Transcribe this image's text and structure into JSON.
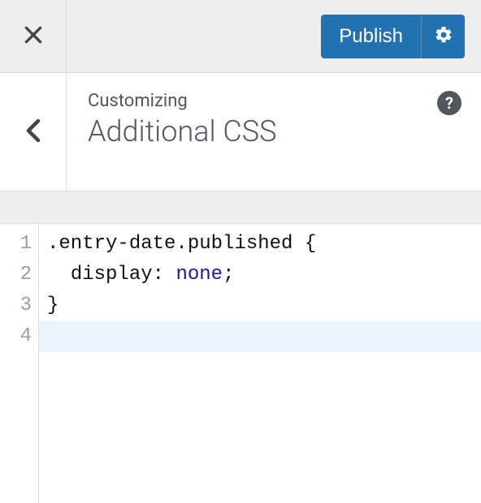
{
  "topbar": {
    "publish_label": "Publish"
  },
  "header": {
    "breadcrumb": "Customizing",
    "title": "Additional CSS",
    "help_char": "?"
  },
  "editor": {
    "active_line": 4,
    "lines": [
      {
        "n": "1",
        "tokens": [
          {
            "t": ".entry-date.published {",
            "c": "plain"
          }
        ]
      },
      {
        "n": "2",
        "tokens": [
          {
            "t": "  ",
            "c": "plain"
          },
          {
            "t": "display",
            "c": "prop"
          },
          {
            "t": ": ",
            "c": "plain"
          },
          {
            "t": "none",
            "c": "val"
          },
          {
            "t": ";",
            "c": "plain"
          }
        ]
      },
      {
        "n": "3",
        "tokens": [
          {
            "t": "}",
            "c": "plain"
          }
        ]
      },
      {
        "n": "4",
        "tokens": [
          {
            "t": "",
            "c": "plain"
          }
        ]
      }
    ]
  }
}
